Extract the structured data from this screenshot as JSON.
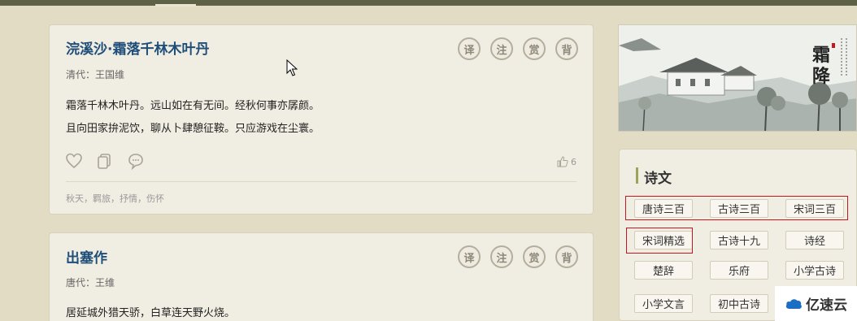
{
  "poems": [
    {
      "title": "浣溪沙·霜落千林木叶丹",
      "author": "清代：王国维",
      "lines": [
        "霜落千林木叶丹。远山如在有无间。经秋何事亦孱颜。",
        "且向田家拚泥饮，聊从卜肆憩征鞍。只应游戏在尘寰。"
      ],
      "likes": "6",
      "tags": "秋天，羁旅，抒情，伤怀"
    },
    {
      "title": "出塞作",
      "author": "唐代：王维",
      "lines": [
        "居延城外猎天骄，白草连天野火烧。"
      ]
    }
  ],
  "poem_buttons": [
    "译",
    "注",
    "赏",
    "背"
  ],
  "icons": {
    "like": "heart-icon",
    "copy": "copy-icon",
    "comment": "comment-icon",
    "thumb": "thumbs-up-icon",
    "cursor": "cursor-icon"
  },
  "banner": {
    "title": "霜降"
  },
  "sidebar": {
    "header": "诗文",
    "tags": [
      "唐诗三百",
      "古诗三百",
      "宋词三百",
      "宋词精选",
      "古诗十九",
      "诗经",
      "楚辞",
      "乐府",
      "小学古诗",
      "小学文言",
      "初中古诗"
    ]
  },
  "watermark": {
    "text": "亿速云"
  },
  "colors": {
    "title": "#1f4e79",
    "accent": "#9aa55b",
    "highlight": "#c8161e",
    "topbar": "#5d6146"
  }
}
